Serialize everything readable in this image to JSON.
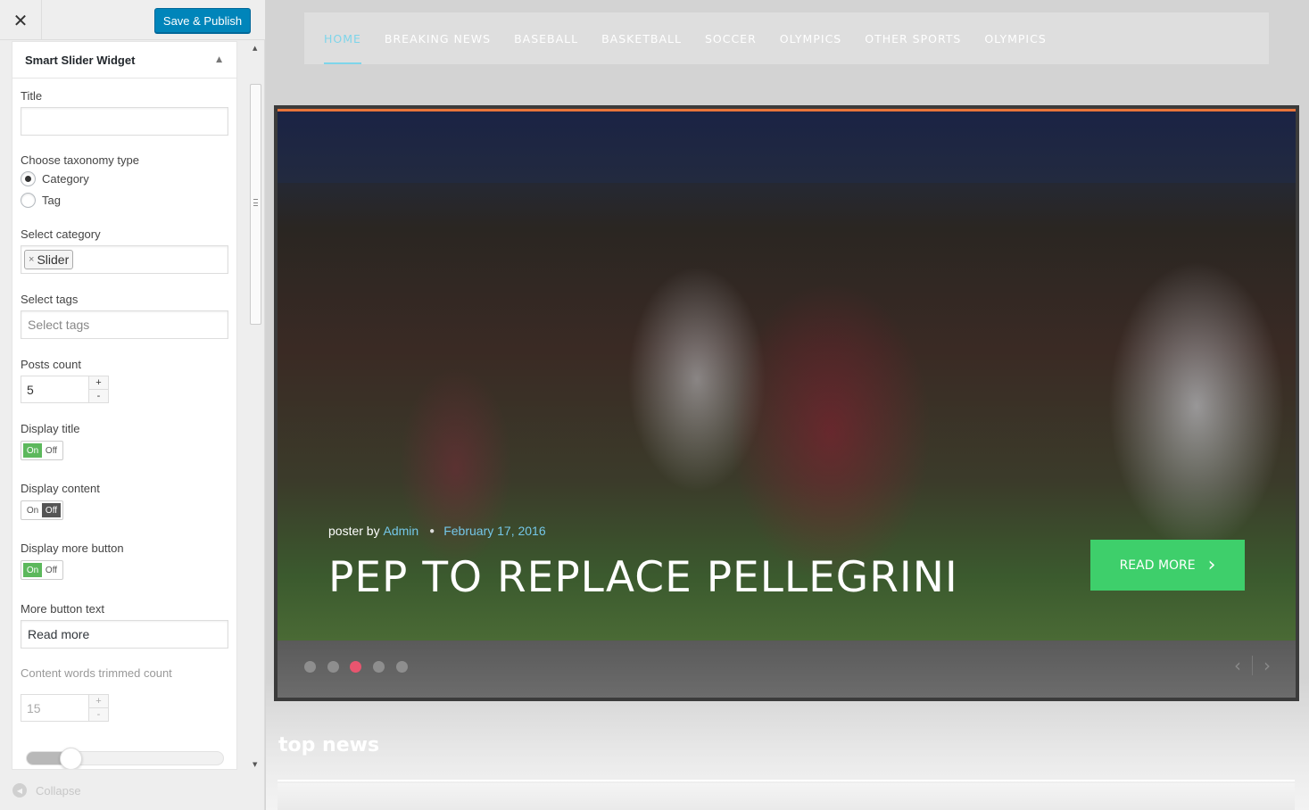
{
  "panel": {
    "close_icon": "close-icon",
    "save_label": "Save & Publish",
    "widget_title": "Smart Slider Widget",
    "fields": {
      "title_label": "Title",
      "title_value": "",
      "taxonomy_label": "Choose taxonomy type",
      "taxonomy_options": [
        "Category",
        "Tag"
      ],
      "taxonomy_selected": "Category",
      "category_label": "Select category",
      "category_token": "Slider",
      "tags_label": "Select tags",
      "tags_placeholder": "Select tags",
      "posts_count_label": "Posts count",
      "posts_count_value": "5",
      "display_title_label": "Display title",
      "display_title_state": "on",
      "display_content_label": "Display content",
      "display_content_state": "off",
      "display_more_label": "Display more button",
      "display_more_state": "on",
      "more_text_label": "More button text",
      "more_text_value": "Read more",
      "trim_label": "Content words trimmed count",
      "trim_value": "15",
      "toggle_on": "On",
      "toggle_off": "Off",
      "range_level": 0.22
    },
    "collapse_label": "Collapse"
  },
  "preview": {
    "nav": [
      "HOME",
      "BREAKING NEWS",
      "BASEBALL",
      "BASKETBALL",
      "SOCCER",
      "OLYMPICS",
      "OTHER SPORTS",
      "OLYMPICS"
    ],
    "nav_active": "HOME",
    "slide": {
      "meta_prefix": "poster by",
      "author": "Admin",
      "date": "February 17, 2016",
      "title": "PEP TO REPLACE PELLEGRINI",
      "read_more": "READ MORE"
    },
    "dots_count": 5,
    "active_dot": 3,
    "section_title": "top news"
  },
  "colors": {
    "publish_blue": "#0085ba",
    "nav_active": "#7ed5ea",
    "read_more_green": "#3ecf6b",
    "slider_accent": "#e8743b",
    "active_dot": "#e8556f",
    "toggle_on": "#5cb85c"
  }
}
